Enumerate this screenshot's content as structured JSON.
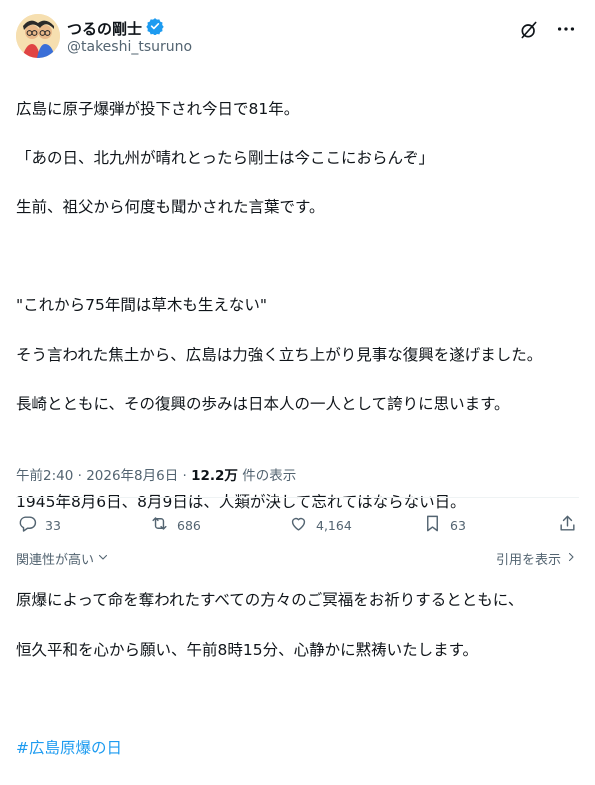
{
  "author": {
    "display_name": "つるの剛士",
    "handle": "@takeshi_tsuruno",
    "verified_color": "#1d9bf0"
  },
  "icons": {
    "header": [
      "avatar",
      "verified-badge-icon",
      "grok-icon",
      "more-icon"
    ],
    "actions": [
      "reply-icon",
      "retweet-icon",
      "like-icon",
      "bookmark-icon",
      "share-icon"
    ],
    "footer": [
      "chevron-down-icon",
      "chevron-right-icon"
    ]
  },
  "post": {
    "lines": [
      "広島に原子爆弾が投下され今日で81年。",
      "「あの日、北九州が晴れとったら剛士は今ここにおらんぞ」",
      "生前、祖父から何度も聞かされた言葉です。",
      "",
      "\"これから75年間は草木も生えない\"",
      "そう言われた焦土から、広島は力強く立ち上がり見事な復興を遂げました。",
      "長崎とともに、その復興の歩みは日本人の一人として誇りに思います。",
      "",
      "1945年8月6日、8月9日は、人類が決して忘れてはならない日。",
      "",
      "原爆によって命を奪われたすべての方々のご冥福をお祈りするとともに、",
      "恒久平和を心から願い、午前8時15分、心静かに黙祷いたします。",
      ""
    ],
    "hashtag": "#広島原爆の日"
  },
  "meta": {
    "time": "午前2:40",
    "separator1": " · ",
    "date": "2026年8月6日",
    "separator2": " · ",
    "views_count": "12.2万",
    "views_label": " 件の表示"
  },
  "actions": {
    "replies": "33",
    "reposts": "686",
    "likes": "4,164",
    "bookmarks": "63"
  },
  "footer": {
    "sort_label": "関連性が高い",
    "quotes_label": "引用を表示"
  },
  "colors": {
    "text": "#0f1419",
    "secondary": "#536471",
    "accent": "#1d9bf0"
  }
}
